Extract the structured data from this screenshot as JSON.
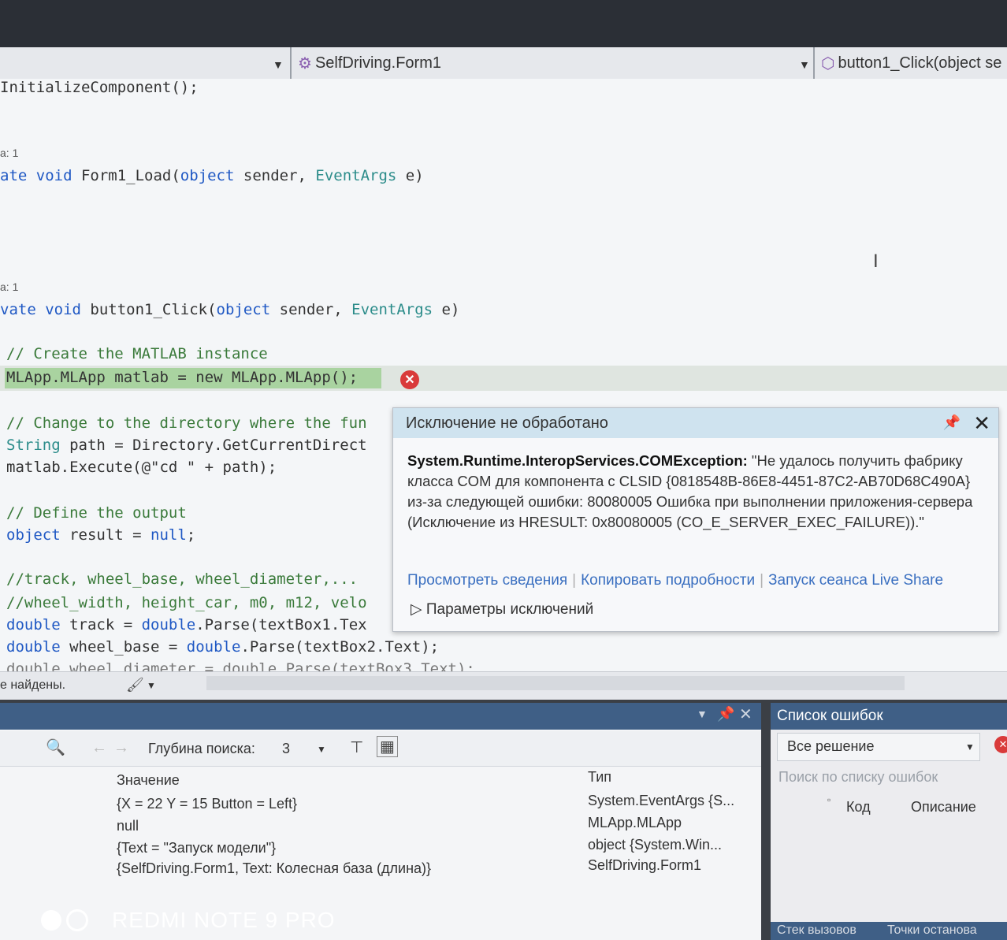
{
  "nav": {
    "class_selector": "SelfDriving.Form1",
    "member_selector": "button1_Click(object se"
  },
  "code": {
    "line1": "InitializeComponent();",
    "ref1": "a: 1",
    "line2_kw": "ate void",
    "line2_rest": " Form1_Load(",
    "line2_obj": "object",
    "line2_mid": " sender, ",
    "line2_ty": "EventArgs",
    "line2_end": " e)",
    "ref2": "a: 1",
    "line3_kw": "vate void",
    "line3_rest": " button1_Click(",
    "line3_obj": "object",
    "line3_mid": " sender, ",
    "line3_ty": "EventArgs",
    "line3_end": " e)",
    "c1": "// Create the MATLAB instance",
    "hl_line": "MLApp.MLApp matlab = new MLApp.MLApp();",
    "c2": "// Change to the directory where the fun",
    "l_path_ty": "String",
    "l_path_rest": " path = Directory.GetCurrentDirect",
    "l_exec": "matlab.Execute(@\"cd \" + path);",
    "c3": "// Define the output",
    "l_res_kw": "object",
    "l_res_rest": " result = ",
    "l_res_null": "null",
    "l_res_end": ";",
    "c4": "//track, wheel_base, wheel_diameter,...",
    "c5": "//wheel_width, height_car, m0, m12, velo",
    "l_track_kw": "double",
    "l_track_rest": " track = ",
    "l_track_kw2": "double",
    "l_track_end": ".Parse(textBox1.Tex",
    "l_wb_kw": "double",
    "l_wb_rest": " wheel_base = ",
    "l_wb_kw2": "double",
    "l_wb_end": ".Parse(textBox2.Text);",
    "l_cut": "double wheel_diameter = double.Parse(textBox3.Text);"
  },
  "popup": {
    "title": "Исключение не обработано",
    "exc_type": "System.Runtime.InteropServices.COMException:",
    "message": " \"Не удалось получить фабрику класса COM для компонента с CLSID {0818548B-86E8-4451-87C2-AB70D68C490A} из-за следующей ошибки: 80080005 Ошибка при выполнении приложения-сервера (Исключение из HRESULT: 0x80080005 (CO_E_SERVER_EXEC_FAILURE)).\"",
    "link1": "Просмотреть сведения",
    "link2": "Копировать подробности",
    "link3": "Запуск сеанса Live Share",
    "params": "▷ Параметры исключений"
  },
  "status": {
    "text": "е найдены."
  },
  "locals": {
    "search_depth_label": "Глубина поиска:",
    "search_depth_value": "3",
    "col_value": "Значение",
    "col_type": "Тип",
    "rows": [
      {
        "value": "{X = 22 Y = 15 Button = Left}",
        "type": "System.EventArgs {S..."
      },
      {
        "value": "null",
        "type": "MLApp.MLApp"
      },
      {
        "value": "{Text = \"Запуск модели\"}",
        "type": "object {System.Win..."
      },
      {
        "value": "{SelfDriving.Form1, Text: Колесная база (длина)}",
        "type": "SelfDriving.Form1"
      }
    ]
  },
  "errorlist": {
    "title": "Список ошибок",
    "scope": "Все решение",
    "search_placeholder": "Поиск по списку ошибок",
    "col_code": "Код",
    "col_desc": "Описание"
  },
  "bottom_tabs": {
    "call_stack": "Стек вызовов",
    "breakpoints": "Точки останова"
  },
  "device": {
    "watermark": "REDMI NOTE 9 PRO"
  }
}
